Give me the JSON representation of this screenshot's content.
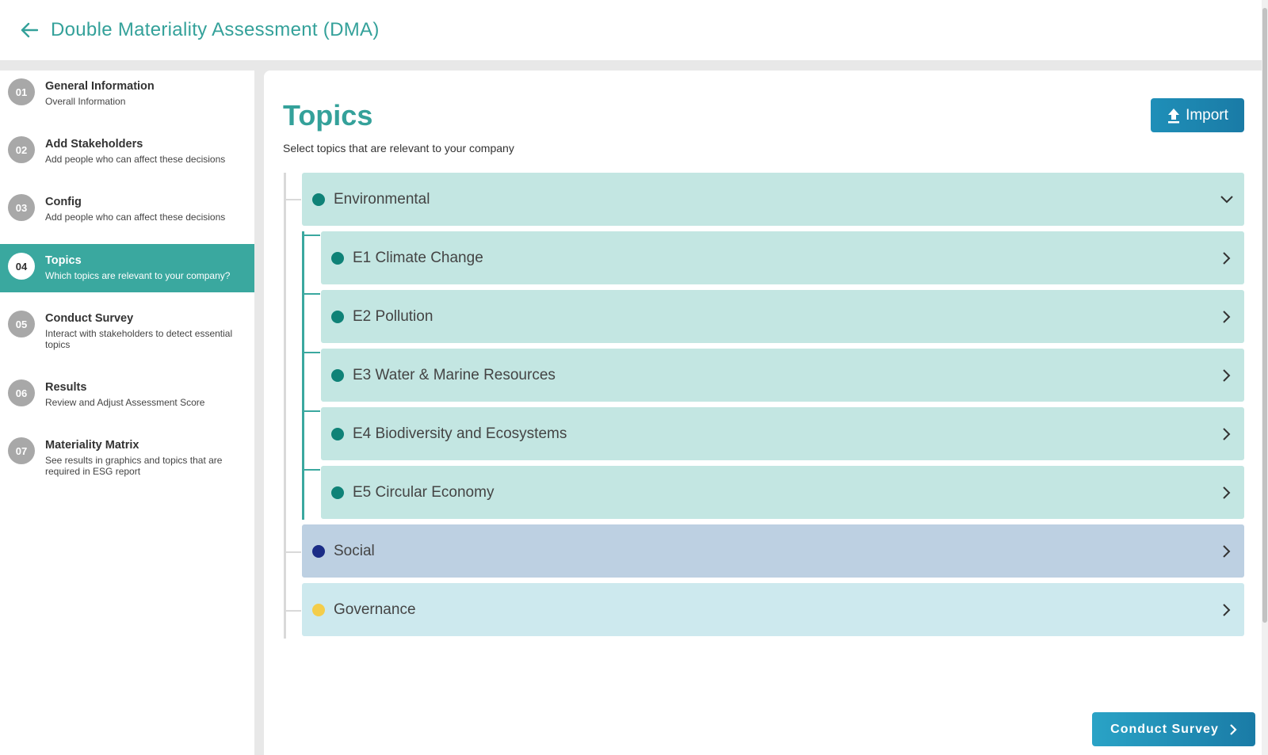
{
  "header": {
    "title": "Double Materiality Assessment (DMA)"
  },
  "sidebar": {
    "steps": [
      {
        "num": "01",
        "title": "General Information",
        "sub": "Overall Information"
      },
      {
        "num": "02",
        "title": "Add Stakeholders",
        "sub": "Add people who can affect these decisions"
      },
      {
        "num": "03",
        "title": "Config",
        "sub": "Add people who can affect these decisions"
      },
      {
        "num": "04",
        "title": "Topics",
        "sub": "Which topics are relevant to your company?"
      },
      {
        "num": "05",
        "title": "Conduct Survey",
        "sub": "Interact with stakeholders to detect essential topics"
      },
      {
        "num": "06",
        "title": "Results",
        "sub": "Review and Adjust Assessment Score"
      },
      {
        "num": "07",
        "title": "Materiality Matrix",
        "sub": "See results in graphics and topics that are required in ESG report"
      }
    ],
    "active_step": "04"
  },
  "main": {
    "title": "Topics",
    "subtitle": "Select topics that are relevant to your company",
    "import_label": "Import",
    "categories": [
      {
        "label": "Environmental",
        "dot_color": "#0f8277",
        "expanded": true,
        "children": [
          {
            "label": "E1 Climate Change"
          },
          {
            "label": "E2 Pollution"
          },
          {
            "label": "E3 Water & Marine Resources"
          },
          {
            "label": "E4 Biodiversity and Ecosystems"
          },
          {
            "label": "E5 Circular Economy"
          }
        ]
      },
      {
        "label": "Social",
        "dot_color": "#1b2c86",
        "expanded": false
      },
      {
        "label": "Governance",
        "dot_color": "#f4cd4a",
        "expanded": false
      }
    ],
    "next_button_label": "Conduct Survey"
  },
  "colors": {
    "accent": "#34a19a",
    "button": "#1a7ba6"
  }
}
